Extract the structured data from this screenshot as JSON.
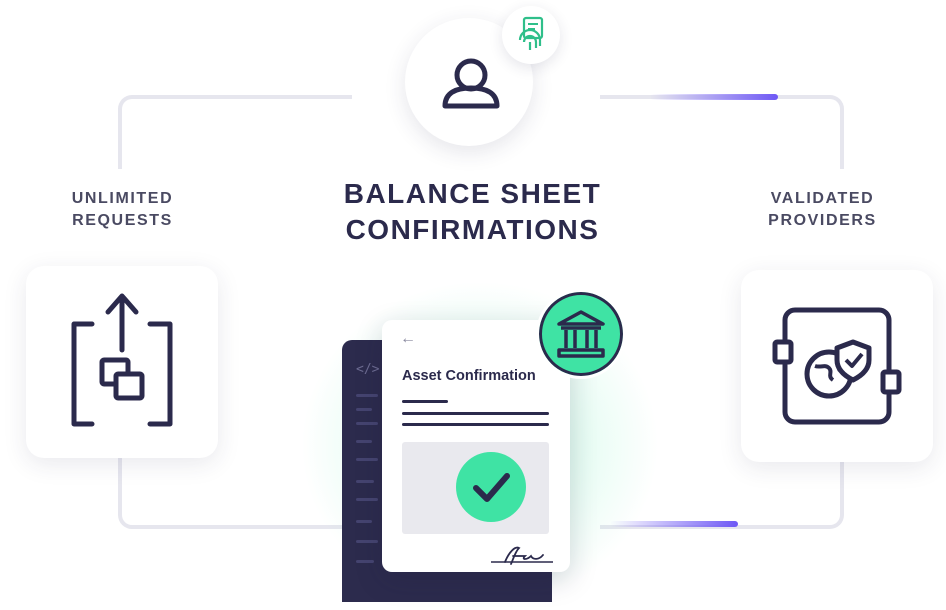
{
  "title": {
    "line1": "BALANCE SHEET",
    "line2": "CONFIRMATIONS"
  },
  "left": {
    "label_line1": "UNLIMITED",
    "label_line2": "REQUESTS",
    "icon": "upload-documents-icon"
  },
  "right": {
    "label_line1": "VALIDATED",
    "label_line2": "PROVIDERS",
    "icon": "verified-provider-globe-icon"
  },
  "top": {
    "icon": "user-icon",
    "badge_icon": "fingerprint-document-icon"
  },
  "document": {
    "back_arrow": "←",
    "title": "Asset Confirmation",
    "status_icon": "checkmark-icon",
    "bank_icon": "bank-icon"
  },
  "code": {
    "tag": "</>"
  },
  "colors": {
    "navy": "#2b2a4c",
    "green": "#3fe3a4",
    "accent": "#6e58f5"
  }
}
